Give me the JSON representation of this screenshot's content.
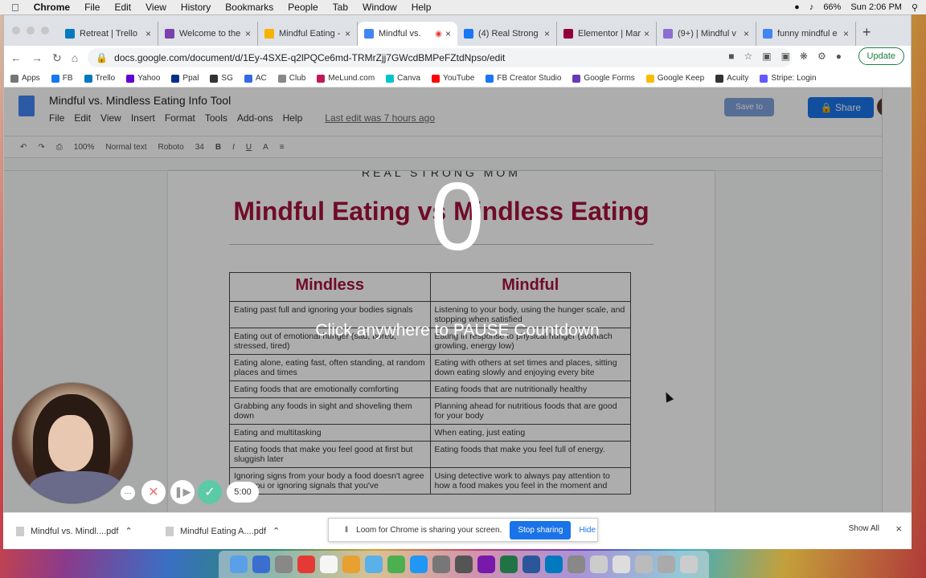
{
  "menubar": {
    "app": "Chrome",
    "items": [
      "File",
      "Edit",
      "View",
      "History",
      "Bookmarks",
      "People",
      "Tab",
      "Window",
      "Help"
    ],
    "battery": "66%",
    "clock": "Sun 2:06 PM"
  },
  "tabs": [
    {
      "title": "Retreat | Trello",
      "color": "#0079bf"
    },
    {
      "title": "Welcome to the",
      "color": "#7b3fb0"
    },
    {
      "title": "Mindful Eating -",
      "color": "#f4b400"
    },
    {
      "title": "Mindful vs. ",
      "color": "#4285f4"
    },
    {
      "title": "(4) Real Strong",
      "color": "#1877f2"
    },
    {
      "title": "Elementor | Mar",
      "color": "#92003b"
    },
    {
      "title": "(9+) | Mindful v",
      "color": "#8a6fd1"
    },
    {
      "title": "funny mindful e",
      "color": "#4285f4"
    }
  ],
  "address": {
    "url": "docs.google.com/document/d/1Ey-4SXE-q2lPQCe6md-TRMrZjj7GWcdBMPeFZtdNpso/edit",
    "update_label": "Update"
  },
  "bookmarks": [
    {
      "label": "Apps",
      "color": "#777"
    },
    {
      "label": "FB",
      "color": "#1877f2"
    },
    {
      "label": "Trello",
      "color": "#0079bf"
    },
    {
      "label": "Yahoo",
      "color": "#6001d2"
    },
    {
      "label": "Ppal",
      "color": "#003087"
    },
    {
      "label": "SG",
      "color": "#333"
    },
    {
      "label": "AC",
      "color": "#356ae6"
    },
    {
      "label": "Club",
      "color": "#888"
    },
    {
      "label": "MeLund.com",
      "color": "#c2185b"
    },
    {
      "label": "Canva",
      "color": "#00c4cc"
    },
    {
      "label": "YouTube",
      "color": "#ff0000"
    },
    {
      "label": "FB Creator Studio",
      "color": "#1877f2"
    },
    {
      "label": "Google Forms",
      "color": "#673ab7"
    },
    {
      "label": "Google Keep",
      "color": "#fbbc04"
    },
    {
      "label": "Acuity",
      "color": "#333"
    },
    {
      "label": "Stripe: Login",
      "color": "#635bff"
    }
  ],
  "doc": {
    "title": "Mindful vs. Mindless Eating Info Tool",
    "menu": [
      "File",
      "Edit",
      "View",
      "Insert",
      "Format",
      "Tools",
      "Add-ons",
      "Help"
    ],
    "last_edit": "Last edit was 7 hours ago",
    "save_to": "Save to",
    "share": "Share",
    "zoom": "100%",
    "style": "Normal text",
    "font": "Roboto",
    "size": "34",
    "brand": "REAL STRONG MOM",
    "heading": "Mindful Eating vs Mindless Eating",
    "table": {
      "headers": [
        "Mindless",
        "Mindful"
      ],
      "rows": [
        [
          "Eating past full and ignoring your bodies signals",
          "Listening to your body, using the hunger scale, and stopping when satisfied"
        ],
        [
          "Eating out of emotional hunger (sad, bored, stressed, tired)",
          "Eating in response to physical hunger (stomach growling, energy low)"
        ],
        [
          "Eating alone, eating fast, often standing, at random places and times",
          "Eating with others at set times and places, sitting down eating slowly and enjoying every bite"
        ],
        [
          "Eating foods that are emotionally comforting",
          "Eating foods that are nutritionally healthy"
        ],
        [
          "Grabbing any foods in sight and shoveling them down",
          "Planning ahead for nutritious foods that are good for your body"
        ],
        [
          "Eating and multitasking",
          "When eating, just eating"
        ],
        [
          "Eating foods that make you feel good at first but sluggish later",
          "Eating foods that make you feel full of energy."
        ],
        [
          "Ignoring signs from your body a food doesn't agree with you or ignoring signals that you've",
          "Using detective work to always pay attention to how a food makes you feel in the moment and"
        ]
      ]
    }
  },
  "overlay": {
    "countdown": "0",
    "pause_text": "Click anywhere to PAUSE Countdown"
  },
  "loom": {
    "timer": "5:00",
    "sharing_text": "Loom for Chrome is sharing your screen.",
    "stop_label": "Stop sharing",
    "hide_label": "Hide"
  },
  "downloads": {
    "items": [
      "Mindful vs. Mindl....pdf",
      "Mindful Eating A....pdf"
    ],
    "show_all": "Show All"
  },
  "dock_colors": [
    "#5aa0e8",
    "#3a6fd0",
    "#888",
    "#e53935",
    "#f5f5f5",
    "#e8a030",
    "#5ab0e8",
    "#4caf50",
    "#2196f3",
    "#777",
    "#555",
    "#7719aa",
    "#217346",
    "#2b579a",
    "#0079bf",
    "#888",
    "#ccc",
    "#ddd",
    "#bbb",
    "#aaa",
    "#ccc"
  ]
}
